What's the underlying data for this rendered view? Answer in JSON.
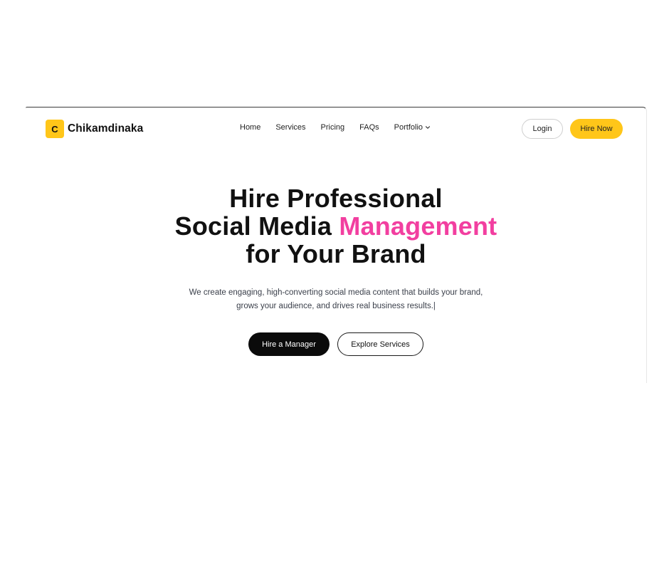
{
  "brand": {
    "logo_letter": "C",
    "name": "Chikamdinaka",
    "accent_color": "#ffc619",
    "highlight_color": "#f23fa0"
  },
  "nav": {
    "items": [
      {
        "label": "Home"
      },
      {
        "label": "Services"
      },
      {
        "label": "Pricing"
      },
      {
        "label": "FAQs"
      },
      {
        "label": "Portfolio",
        "icon": "chevron-down-icon"
      }
    ],
    "login_label": "Login",
    "hire_now_label": "Hire Now"
  },
  "hero": {
    "title_line1": "Hire Professional",
    "title_line2_prefix": "Social Media ",
    "title_line2_highlight": "Management",
    "title_line3": "for Your Brand",
    "subtitle_line1": "We create engaging, high-converting social media content that builds your brand,",
    "subtitle_line2": "grows your audience, and drives real business results.|",
    "primary_cta": "Hire a Manager",
    "secondary_cta": "Explore Services"
  }
}
